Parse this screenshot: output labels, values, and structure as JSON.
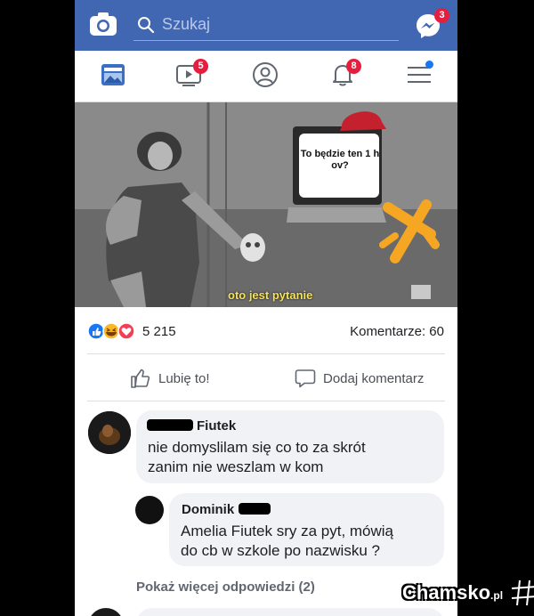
{
  "header": {
    "search_placeholder": "Szukaj",
    "messenger_badge": "3"
  },
  "nav": {
    "video_badge": "5",
    "notifications_badge": "8"
  },
  "post": {
    "meme_tv_text": "To będzie ten 1 h ov?",
    "meme_caption": "oto jest pytanie",
    "reaction_count": "5 215",
    "comments_label": "Komentarze: 60",
    "like_label": "Lubię to!",
    "comment_label": "Dodaj komentarz"
  },
  "comments": [
    {
      "name": "Fiutek",
      "text_line1": "nie domyslilam się co to za skrót",
      "text_line2": "zanim nie weszlam w kom"
    },
    {
      "name": "Dominik",
      "text_line1": "Amelia Fiutek sry za pyt, mówią",
      "text_line2": "do cb w szkole po nazwisku ?"
    }
  ],
  "more_replies": "Pokaż więcej odpowiedzi (2)",
  "watermark": {
    "main": "Chamsko",
    "suffix": ".pl"
  },
  "colors": {
    "brand": "#4267b2",
    "badge": "#e41e3f",
    "bubble": "#f0f2f5"
  }
}
